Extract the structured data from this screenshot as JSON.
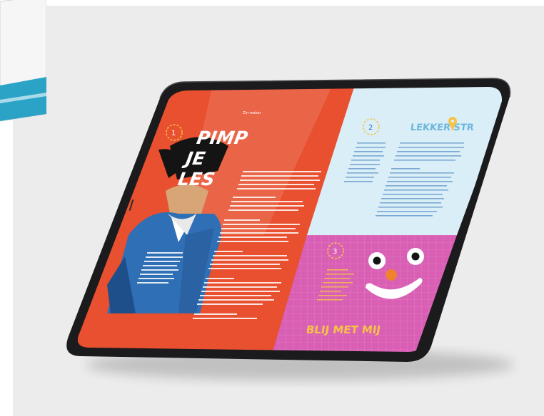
{
  "spread": {
    "page1": {
      "number": "1",
      "title_line1": "PIMP",
      "title_line2": "JE",
      "title_line3": "LES",
      "header_small": "Zin-maker"
    },
    "page2": {
      "number": "2",
      "title": "LEKKER STR"
    },
    "page3": {
      "number": "3",
      "title": "BLIJ MET MIJ"
    }
  },
  "colors": {
    "background_panel": "#ececec",
    "page_red": "#e8502f",
    "page_blue": "#d9eef7",
    "page_pink": "#d95fb4",
    "title_yellow": "#f6c445",
    "device_frame": "#1b1b1d"
  }
}
